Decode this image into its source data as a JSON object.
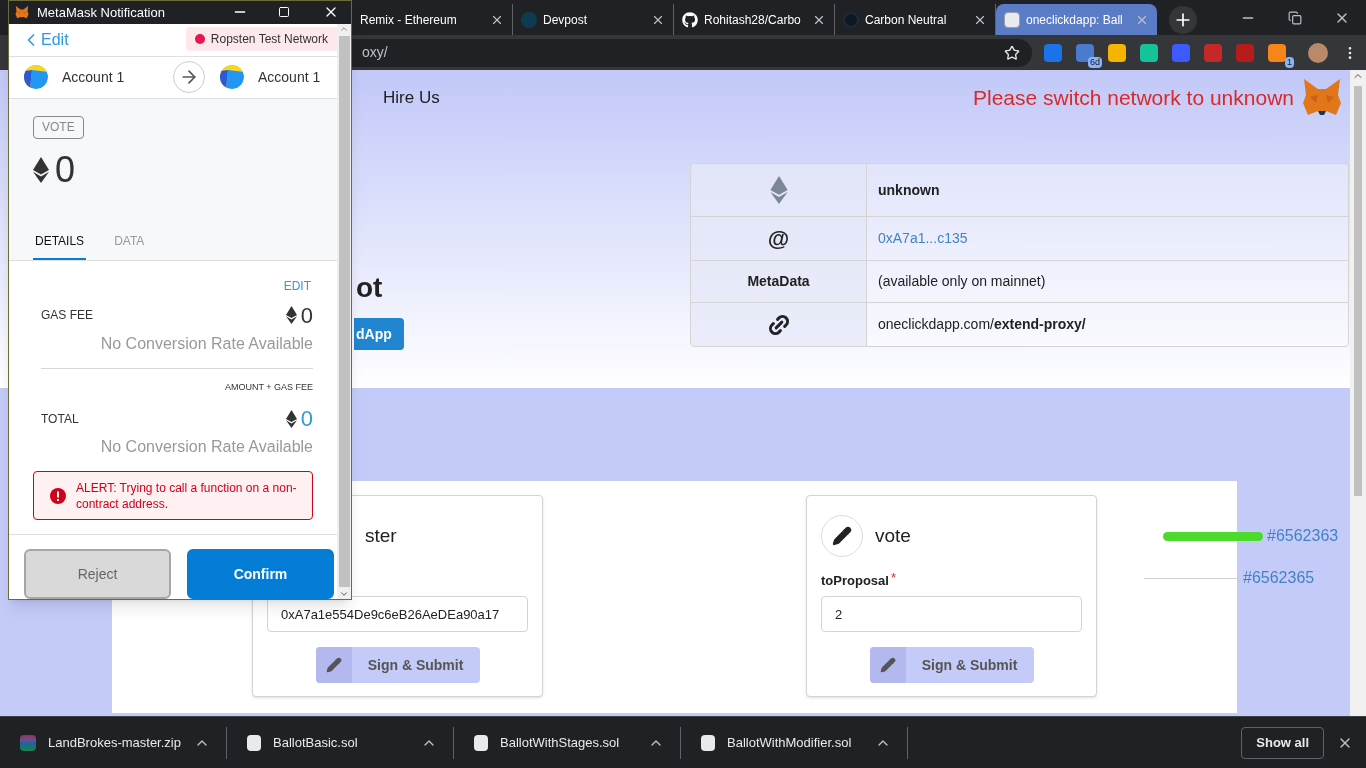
{
  "browser": {
    "tabs": [
      {
        "title": "Remix - Ethereum",
        "kind": "plain",
        "selected": false
      },
      {
        "title": "Devpost",
        "kind": "circle",
        "selected": false
      },
      {
        "title": "Rohitash28/Carbo",
        "kind": "github",
        "selected": false
      },
      {
        "title": "Carbon Neutral",
        "kind": "ring",
        "selected": false
      },
      {
        "title": "oneclickdapp: Ball",
        "kind": "doc",
        "selected": true
      }
    ],
    "address": "oxy/",
    "extensions": [
      {
        "color": "#1a73e8"
      },
      {
        "color": "#4a7bd0",
        "badge": "6d"
      },
      {
        "color": "#f4b400"
      },
      {
        "color": "#15c39a"
      },
      {
        "color": "#3d5afe"
      },
      {
        "color": "#c62828"
      },
      {
        "color": "#b71c1c"
      },
      {
        "color": "#f6851b",
        "badge": "1"
      }
    ]
  },
  "page": {
    "nav": [
      "Hire Us"
    ],
    "network_warning": "Please switch network to unknown",
    "title": "ot",
    "hero_button": "dApp",
    "info_rows": [
      {
        "kind": "network",
        "value": "unknown"
      },
      {
        "kind": "address",
        "label": "@",
        "value": "0xA7a1...c135"
      },
      {
        "kind": "text",
        "label": "MetaData",
        "value": "(available only on mainnet)"
      },
      {
        "kind": "url",
        "value": "oneclickdapp.com/**extend-proxy/**"
      }
    ],
    "functions": [
      {
        "title": "ster",
        "icon": false,
        "field": {
          "value": "0xA7a1e554De9c6eB26AeDEa90a17"
        },
        "button": "Sign & Submit"
      },
      {
        "title": "vote",
        "icon": true,
        "field": {
          "label": "toProposal",
          "required_mark": "*",
          "value": "2"
        },
        "button": "Sign & Submit"
      }
    ],
    "history": [
      {
        "label": "#6562363",
        "selected": true
      },
      {
        "label": "#6562365",
        "selected": false
      }
    ]
  },
  "downloads": {
    "items": [
      {
        "name": "LandBrokes-master.zip",
        "kind": "archive"
      },
      {
        "name": "BallotBasic.sol",
        "kind": "file"
      },
      {
        "name": "BallotWithStages.sol",
        "kind": "file"
      },
      {
        "name": "BallotWithModifier.sol",
        "kind": "file"
      }
    ],
    "show_all": "Show all"
  },
  "popup": {
    "title": "MetaMask Notification",
    "back": "Edit",
    "network": "Ropsten Test Network",
    "from": "Account 1",
    "to": "Account 1",
    "method": "VOTE",
    "amount": "0",
    "tabs": [
      {
        "label": "DETAILS",
        "selected": true
      },
      {
        "label": "DATA",
        "selected": false
      }
    ],
    "edit": "EDIT",
    "gas_fee": {
      "label": "GAS FEE",
      "value": "0",
      "conversion": "No Conversion Rate Available"
    },
    "total": {
      "caption": "AMOUNT + GAS FEE",
      "label": "TOTAL",
      "value": "0",
      "conversion": "No Conversion Rate Available"
    },
    "alert": "ALERT: Trying to call a function on a non-contract address.",
    "buttons": [
      {
        "label": "Reject",
        "kind": "secondary"
      },
      {
        "label": "Confirm",
        "kind": "primary"
      }
    ]
  }
}
